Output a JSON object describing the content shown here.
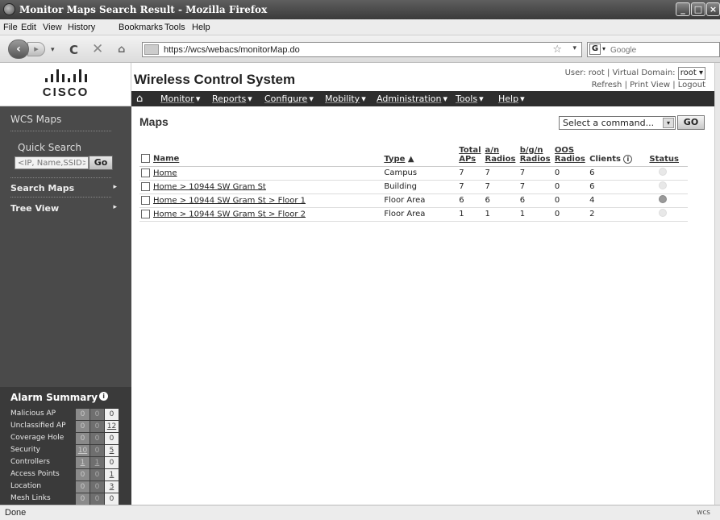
{
  "window": {
    "title": "Monitor Maps Search Result - Mozilla Firefox"
  },
  "menubar": [
    "File",
    "Edit",
    "View",
    "History",
    "Bookmarks",
    "Tools",
    "Help"
  ],
  "navbar": {
    "url": "https://wcs/webacs/monitorMap.do",
    "search_placeholder": "Google",
    "search_engine": "G"
  },
  "header": {
    "logo_text": "CISCO",
    "app_title": "Wireless Control System",
    "user_line": "User: root  |  Virtual Domain:",
    "domain": "root",
    "links": "Refresh  |  Print View  |  Logout"
  },
  "mainnav": [
    "Monitor",
    "Reports",
    "Configure",
    "Mobility",
    "Administration",
    "Tools",
    "Help"
  ],
  "sidebar": {
    "title": "WCS Maps",
    "quick_search": "Quick Search",
    "quick_search_placeholder": "<IP, Name,SSID>",
    "go": "Go",
    "items": [
      "Search Maps",
      "Tree View"
    ]
  },
  "alarm": {
    "title": "Alarm Summary",
    "rows": [
      {
        "label": "Malicious AP",
        "values": [
          "0",
          "0",
          "0"
        ]
      },
      {
        "label": "Unclassified AP",
        "values": [
          "0",
          "0",
          "12"
        ]
      },
      {
        "label": "Coverage Hole",
        "values": [
          "0",
          "0",
          "0"
        ]
      },
      {
        "label": "Security",
        "values": [
          "10",
          "0",
          "5"
        ]
      },
      {
        "label": "Controllers",
        "values": [
          "1",
          "1",
          "0"
        ]
      },
      {
        "label": "Access Points",
        "values": [
          "0",
          "0",
          "1"
        ]
      },
      {
        "label": "Location",
        "values": [
          "0",
          "0",
          "3"
        ]
      },
      {
        "label": "Mesh Links",
        "values": [
          "0",
          "0",
          "0"
        ]
      }
    ]
  },
  "content": {
    "title": "Maps",
    "command_select": "Select a command...",
    "go": "GO",
    "columns": {
      "name": "Name",
      "type": "Type",
      "total_aps": [
        "Total",
        "APs"
      ],
      "an": [
        "a/n",
        "Radios"
      ],
      "bgn": [
        "b/g/n",
        "Radios"
      ],
      "oos": [
        "OOS",
        "Radios"
      ],
      "clients": "Clients",
      "status": "Status"
    },
    "rows": [
      {
        "name": "Home",
        "type": "Campus",
        "total": "7",
        "an": "7",
        "bgn": "7",
        "oos": "0",
        "clients": "6",
        "status": "off"
      },
      {
        "name": "Home > 10944 SW Gram St",
        "type": "Building",
        "total": "7",
        "an": "7",
        "bgn": "7",
        "oos": "0",
        "clients": "6",
        "status": "off"
      },
      {
        "name": "Home > 10944 SW Gram St > Floor 1",
        "type": "Floor Area",
        "total": "6",
        "an": "6",
        "bgn": "6",
        "oos": "0",
        "clients": "4",
        "status": "on"
      },
      {
        "name": "Home > 10944 SW Gram St > Floor 2",
        "type": "Floor Area",
        "total": "1",
        "an": "1",
        "bgn": "1",
        "oos": "0",
        "clients": "2",
        "status": "off"
      }
    ]
  },
  "statusbar": {
    "text": "Done",
    "right": "wcs"
  }
}
